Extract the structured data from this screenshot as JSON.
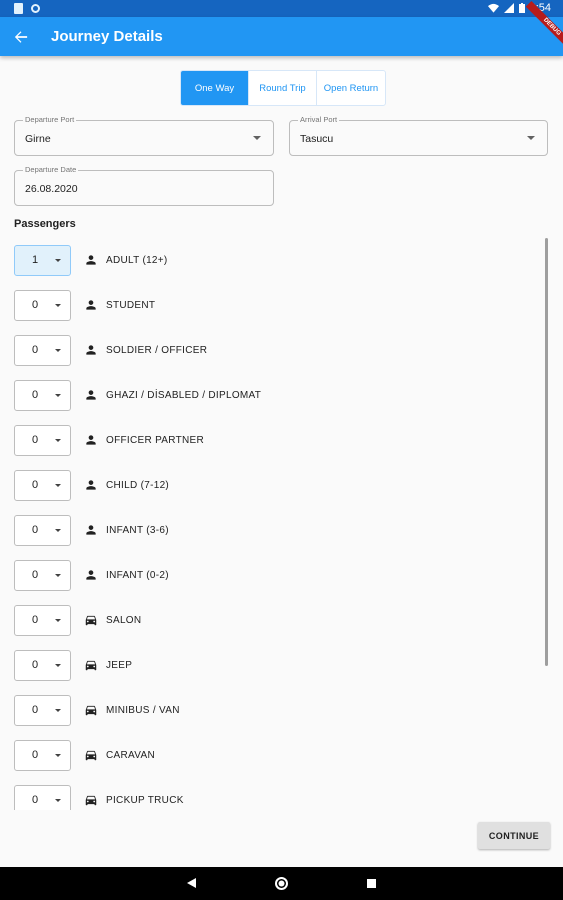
{
  "status_bar": {
    "time": "3:54"
  },
  "app_bar": {
    "title": "Journey Details",
    "debug_label": "DEBUG"
  },
  "trip_types": [
    {
      "label": "One Way",
      "active": true
    },
    {
      "label": "Round Trip",
      "active": false
    },
    {
      "label": "Open Return",
      "active": false
    }
  ],
  "departure_port": {
    "label": "Departure Port",
    "value": "Girne"
  },
  "arrival_port": {
    "label": "Arrival Port",
    "value": "Tasucu"
  },
  "departure_date": {
    "label": "Departure Date",
    "value": "26.08.2020"
  },
  "passengers_title": "Passengers",
  "rows": [
    {
      "count": "1",
      "label": "ADULT (12+)",
      "icon": "person-icon"
    },
    {
      "count": "0",
      "label": "STUDENT",
      "icon": "person-icon"
    },
    {
      "count": "0",
      "label": "SOLDIER / OFFICER",
      "icon": "person-icon"
    },
    {
      "count": "0",
      "label": "GHAZI / DİSABLED / DIPLOMAT",
      "icon": "person-icon"
    },
    {
      "count": "0",
      "label": "OFFICER PARTNER",
      "icon": "person-icon"
    },
    {
      "count": "0",
      "label": "CHILD (7-12)",
      "icon": "person-icon"
    },
    {
      "count": "0",
      "label": "INFANT (3-6)",
      "icon": "person-icon"
    },
    {
      "count": "0",
      "label": "INFANT (0-2)",
      "icon": "person-icon"
    },
    {
      "count": "0",
      "label": "SALON",
      "icon": "car-icon"
    },
    {
      "count": "0",
      "label": "JEEP",
      "icon": "car-icon"
    },
    {
      "count": "0",
      "label": "MINIBUS / VAN",
      "icon": "car-icon"
    },
    {
      "count": "0",
      "label": "CARAVAN",
      "icon": "car-icon"
    },
    {
      "count": "0",
      "label": "PICKUP TRUCK",
      "icon": "car-icon"
    }
  ],
  "continue_label": "CONTINUE",
  "colors": {
    "primary": "#2196f3",
    "status_bar": "#1565c0"
  }
}
